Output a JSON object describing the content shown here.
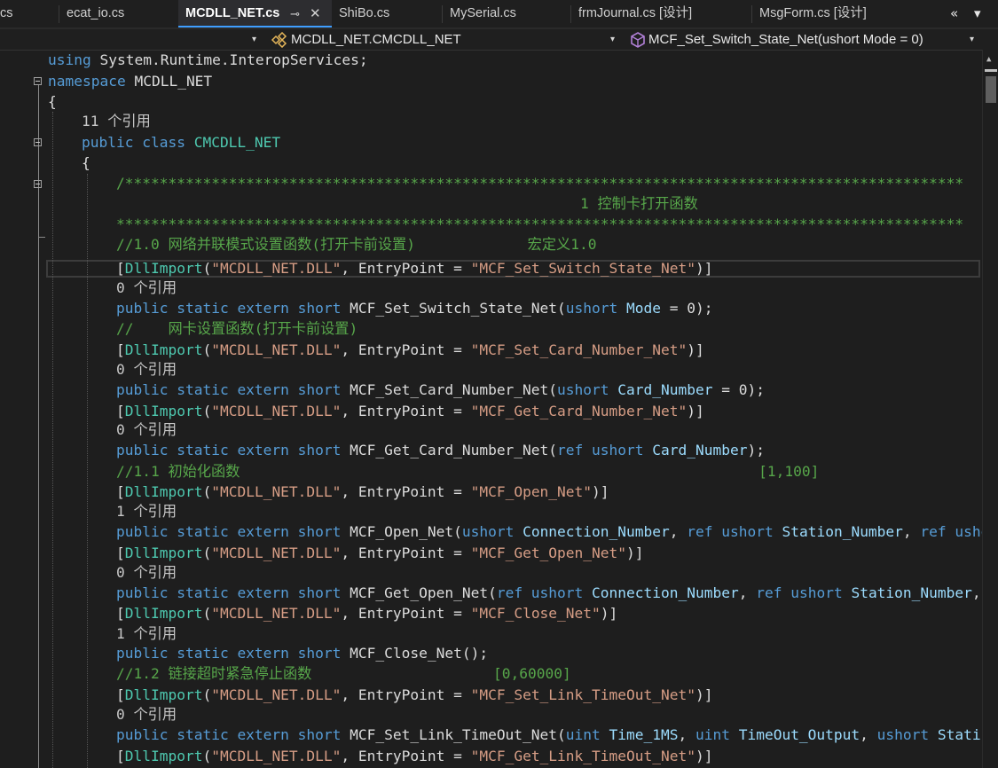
{
  "tabs": [
    {
      "label": "cs"
    },
    {
      "label": "ecat_io.cs"
    },
    {
      "label": "MCDLL_NET.cs",
      "active": true
    },
    {
      "label": "ShiBo.cs"
    },
    {
      "label": "MySerial.cs"
    },
    {
      "label": "frmJournal.cs [设计]"
    },
    {
      "label": "MsgForm.cs [设计]"
    }
  ],
  "tab_glyphs": {
    "pin": "⊸",
    "close": "✕",
    "overflow_left": "«",
    "dropdown": "▾"
  },
  "nav": {
    "class_dropdown": "MCDLL_NET.CMCDLL_NET",
    "member_dropdown": "MCF_Set_Switch_State_Net(ushort Mode = 0)",
    "caret": "▾"
  },
  "code": {
    "l1": {
      "kw": "using",
      "rest": " System.Runtime.InteropServices;"
    },
    "l2": {
      "kw": "namespace",
      "rest": " MCDLL_NET"
    },
    "l3": {
      "text": "{"
    },
    "l4": {
      "text": "11 个引用"
    },
    "l5": {
      "kw": "public class",
      "type": "CMCDLL_NET"
    },
    "l6": {
      "text": "{"
    },
    "l7": {
      "text": "/*************************************************************************************************"
    },
    "l8": {
      "text": "1 控制卡打开函数"
    },
    "l9": {
      "text": "**************************************************************************************************"
    },
    "l10": {
      "text": "//1.0 网络并联模式设置函数(打开卡前设置)             宏定义1.0"
    },
    "l11": {
      "attr": "DllImport",
      "str1": "\"MCDLL_NET.DLL\"",
      "mid": ", EntryPoint = ",
      "str2": "\"MCF_Set_Switch_State_Net\""
    },
    "l12": {
      "text": "0 个引用"
    },
    "l13": {
      "kw": "public static extern short",
      "name": " MCF_Set_Switch_State_Net(",
      "ptype": "ushort",
      "param": " Mode",
      "tail": " = 0);"
    },
    "l14": {
      "text": "//    网卡设置函数(打开卡前设置)"
    },
    "l15": {
      "attr": "DllImport",
      "str1": "\"MCDLL_NET.DLL\"",
      "mid": ", EntryPoint = ",
      "str2": "\"MCF_Set_Card_Number_Net\""
    },
    "l16": {
      "text": "0 个引用"
    },
    "l17": {
      "kw": "public static extern short",
      "name": " MCF_Set_Card_Number_Net(",
      "ptype": "ushort",
      "param": " Card_Number",
      "tail": " = 0);"
    },
    "l18": {
      "attr": "DllImport",
      "str1": "\"MCDLL_NET.DLL\"",
      "mid": ", EntryPoint = ",
      "str2": "\"MCF_Get_Card_Number_Net\""
    },
    "l19": {
      "text": "0 个引用"
    },
    "l20": {
      "kw": "public static extern short",
      "name": " MCF_Get_Card_Number_Net(",
      "ref": "ref ushort",
      "param": " Card_Number",
      "tail": ");"
    },
    "l21": {
      "text": "//1.1 初始化函数                                                            [1,100]"
    },
    "l22": {
      "attr": "DllImport",
      "str1": "\"MCDLL_NET.DLL\"",
      "mid": ", EntryPoint = ",
      "str2": "\"MCF_Open_Net\""
    },
    "l23": {
      "text": "1 个引用"
    },
    "l24": {
      "kw": "public static extern short",
      "name": " MCF_Open_Net(",
      "ptype": "ushort",
      "param": " Connection_Number",
      "sep": ", ",
      "ref": "ref ushort",
      "param2": " Station_Number",
      "sep2": ", ",
      "ref2": "ref usho"
    },
    "l25": {
      "attr": "DllImport",
      "str1": "\"MCDLL_NET.DLL\"",
      "mid": ", EntryPoint = ",
      "str2": "\"MCF_Get_Open_Net\""
    },
    "l26": {
      "text": "0 个引用"
    },
    "l27": {
      "kw": "public static extern short",
      "name": " MCF_Get_Open_Net(",
      "ref": "ref ushort",
      "param": " Connection_Number",
      "sep": ", ",
      "ref2": "ref ushort",
      "param2": " Station_Number",
      "tail": ","
    },
    "l28": {
      "attr": "DllImport",
      "str1": "\"MCDLL_NET.DLL\"",
      "mid": ", EntryPoint = ",
      "str2": "\"MCF_Close_Net\""
    },
    "l29": {
      "text": "1 个引用"
    },
    "l30": {
      "kw": "public static extern short",
      "name": " MCF_Close_Net();"
    },
    "l31": {
      "text": "//1.2 链接超时紧急停止函数                     [0,60000]"
    },
    "l32": {
      "attr": "DllImport",
      "str1": "\"MCDLL_NET.DLL\"",
      "mid": ", EntryPoint = ",
      "str2": "\"MCF_Set_Link_TimeOut_Net\""
    },
    "l33": {
      "text": "0 个引用"
    },
    "l34": {
      "kw": "public static extern short",
      "name": " MCF_Set_Link_TimeOut_Net(",
      "ptype": "uint",
      "param": " Time_1MS",
      "sep": ", ",
      "ptype2": "uint",
      "param2": " TimeOut_Output",
      "sep2": ", ",
      "ptype3": "ushort",
      "param3": " Static"
    },
    "l35": {
      "attr": "DllImport",
      "str1": "\"MCDLL_NET.DLL\"",
      "mid": ", EntryPoint = ",
      "str2": "\"MCF_Get_Link_TimeOut_Net\""
    }
  },
  "colors": {
    "keyword": "#569cd6",
    "type": "#4ec9b0",
    "comment": "#57a64a",
    "string": "#d69d85",
    "parameter": "#9cdcfe",
    "text": "#dcdcdc",
    "background": "#1e1e1e",
    "active_tab_accent": "#3f9eff"
  }
}
